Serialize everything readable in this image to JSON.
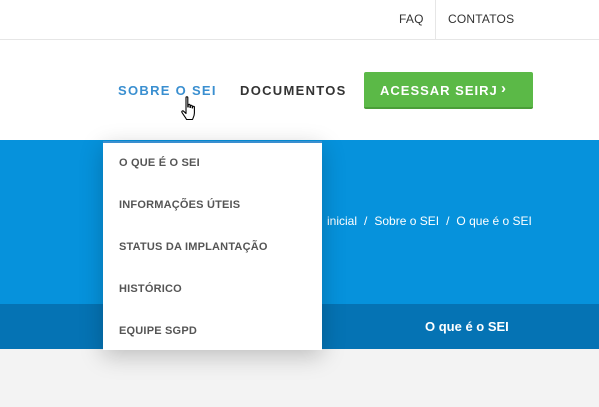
{
  "topbar": {
    "faq": "FAQ",
    "contatos": "CONTATOS"
  },
  "nav": {
    "sobre": "SOBRE O SEI",
    "documentos": "DOCUMENTOS",
    "cta_label": "ACESSAR SEIRJ",
    "cta_chevron": "›"
  },
  "dropdown": {
    "items": [
      "O QUE É O SEI",
      "INFORMAÇÕES ÚTEIS",
      "STATUS DA IMPLANTAÇÃO",
      "HISTÓRICO",
      "EQUIPE SGPD"
    ]
  },
  "breadcrumb": {
    "home": "inicial",
    "section": "Sobre o SEI",
    "current": "O que é o SEI",
    "separator": "/"
  },
  "page_title": "O que é o SEI",
  "colors": {
    "accent": "#3a8fd0",
    "cta_green": "#5bb947",
    "hero_blue": "#0692dc",
    "titlebar_blue": "#0573b4"
  },
  "icons": {
    "cursor": "hand-pointer-icon",
    "cta": "chevron-right-icon"
  }
}
